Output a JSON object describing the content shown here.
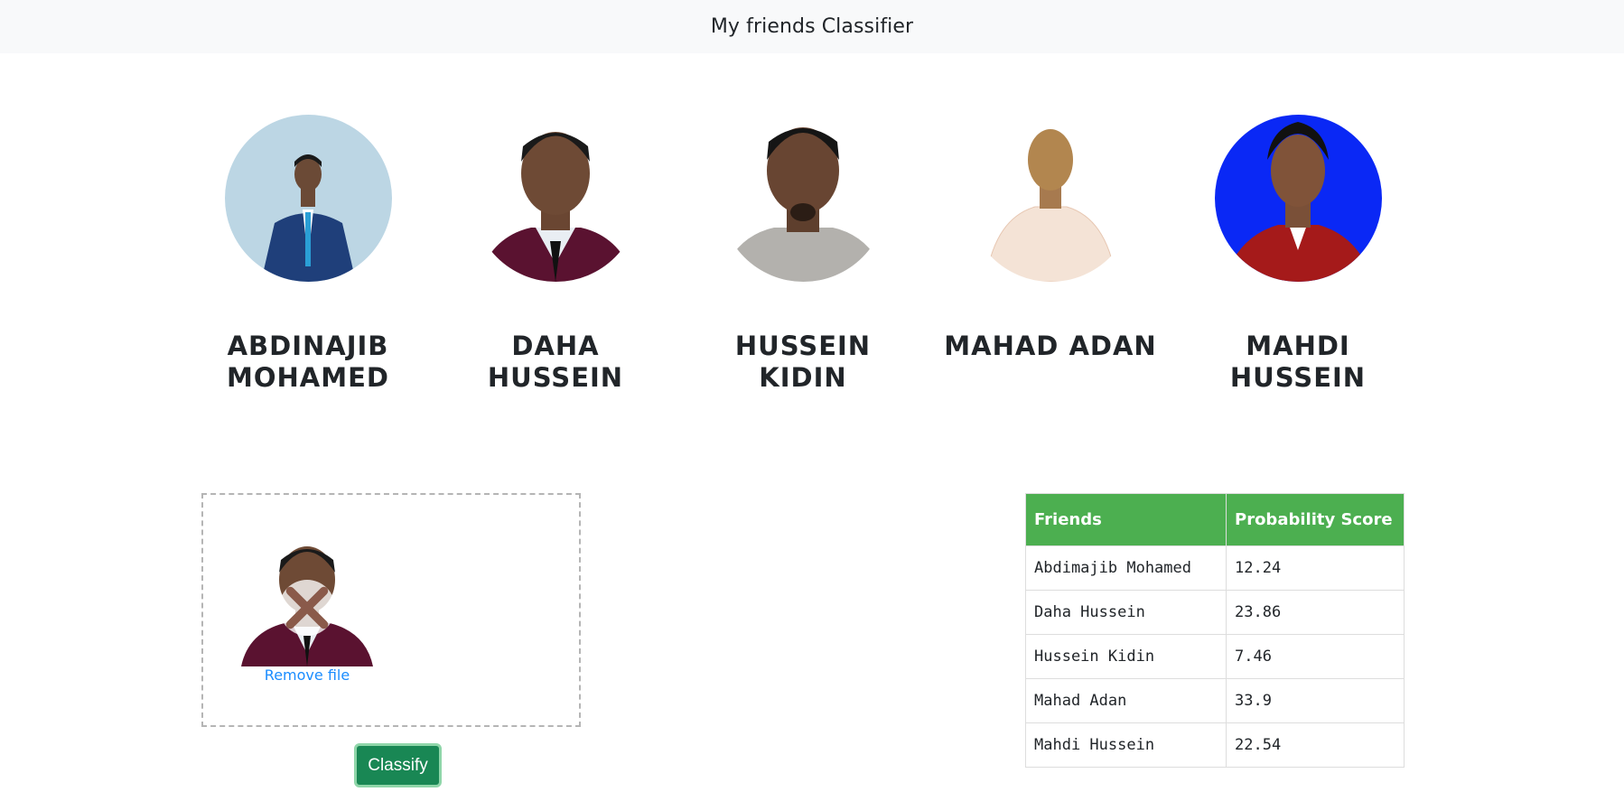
{
  "navbar": {
    "title": "My friends Classifier"
  },
  "friends": [
    {
      "name": "ABDINAJIB MOHAMED"
    },
    {
      "name": "DAHA HUSSEIN"
    },
    {
      "name": "HUSSEIN KIDIN"
    },
    {
      "name": "MAHAD ADAN"
    },
    {
      "name": "MAHDI HUSSEIN"
    }
  ],
  "upload": {
    "remove_label": "Remove file",
    "classify_label": "Classify"
  },
  "results": {
    "headers": [
      "Friends",
      "Probability Score"
    ],
    "rows": [
      {
        "friend": "Abdimajib Mohamed",
        "score": "12.24"
      },
      {
        "friend": "Daha Hussein",
        "score": "23.86"
      },
      {
        "friend": "Hussein Kidin",
        "score": "7.46"
      },
      {
        "friend": "Mahad Adan",
        "score": "33.9"
      },
      {
        "friend": "Mahdi Hussein",
        "score": "22.54"
      }
    ]
  },
  "colors": {
    "table_header": "#4caf50",
    "classify_button": "#198754",
    "link": "#1a8cff",
    "navbar_bg": "#f8f9fa"
  }
}
